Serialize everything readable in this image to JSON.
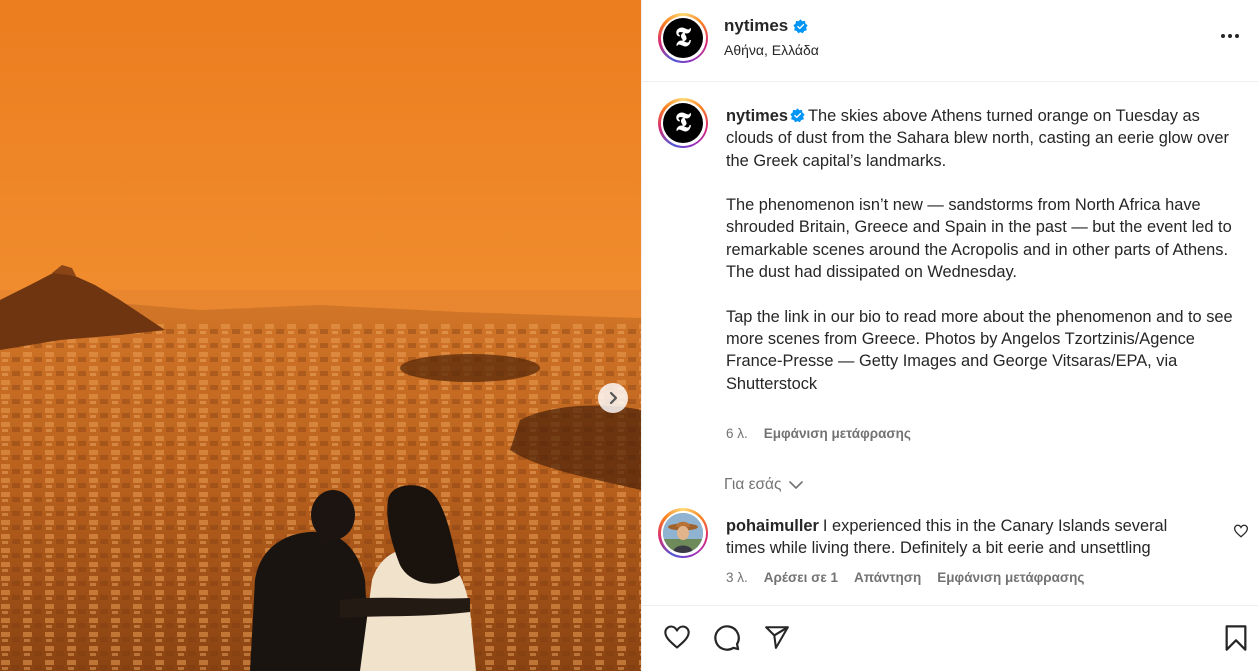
{
  "post": {
    "username": "nytimes",
    "verified": true,
    "location": "Αθήνα, Ελλάδα",
    "avatar_letter": "𝕿",
    "more_icon": "more-horizontal-icon",
    "next_icon": "chevron-right-icon"
  },
  "caption": {
    "username": "nytimes",
    "first_text": "The skies above Athens turned orange on Tuesday as clouds of dust from the Sahara blew north, casting an eerie glow over the Greek capital’s landmarks.",
    "paragraph_2": "The phenomenon isn’t new — sandstorms from North Africa have shrouded Britain, Greece and Spain in the past — but the event led to remarkable scenes around the Acropolis and in other parts of Athens.",
    "paragraph_3": "The dust had dissipated on Wednesday.",
    "paragraph_4": "Tap the link in our bio to read more about the phenomenon and to see more scenes from Greece. Photos by Angelos Tzortzinis/Agence France-Presse — Getty Images and George Vitsaras/EPA, via Shutterstock",
    "age": "6 λ.",
    "translate_label": "Εμφάνιση μετάφρασης"
  },
  "for_you": {
    "label": "Για εσάς",
    "icon": "chevron-down-icon"
  },
  "comments": [
    {
      "username": "pohaimuller",
      "text": "I experienced this in the Canary Islands several times while living there. Definitely a bit eerie and unsettling",
      "age": "3 λ.",
      "likes_label": "Αρέσει σε 1",
      "reply_label": "Απάντηση",
      "translate_label": "Εμφάνιση μετάφρασης"
    }
  ],
  "actions": {
    "like_icon": "heart-icon",
    "comment_icon": "comment-icon",
    "share_icon": "share-icon",
    "save_icon": "bookmark-icon"
  },
  "colors": {
    "sky": "#f0892a",
    "verified": "#0095f6",
    "muted_text": "#737373"
  }
}
